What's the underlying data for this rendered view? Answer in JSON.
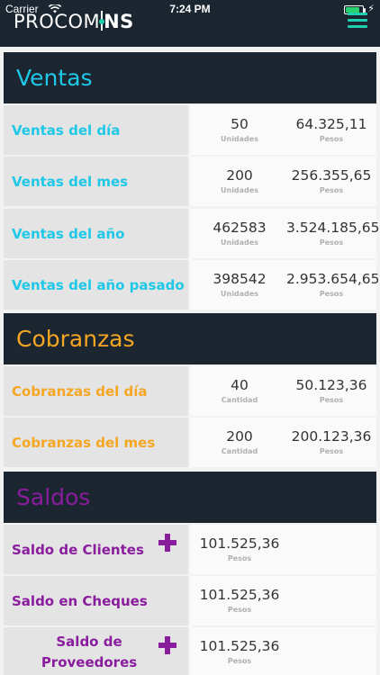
{
  "status_bar": {
    "carrier": "Carrier",
    "time": "7:24 PM"
  },
  "app": {
    "logo_light": "PROCOM",
    "logo_bold": "NS"
  },
  "colors": {
    "ventas": "#1ec8e6",
    "cobranzas": "#f5a623",
    "saldos": "#8a1c9e",
    "header_bg": "#1b2631"
  },
  "ventas": {
    "title": "Ventas",
    "rows": [
      {
        "label": "Ventas del día",
        "qty": "50",
        "qty_unit": "Unidades",
        "amount": "64.325,11",
        "amount_unit": "Pesos"
      },
      {
        "label": "Ventas del mes",
        "qty": "200",
        "qty_unit": "Unidades",
        "amount": "256.355,65",
        "amount_unit": "Pesos"
      },
      {
        "label": "Ventas del año",
        "qty": "462583",
        "qty_unit": "Unidades",
        "amount": "3.524.185,65",
        "amount_unit": "Pesos"
      },
      {
        "label": "Ventas del año pasado",
        "qty": "398542",
        "qty_unit": "Unidades",
        "amount": "2.953.654,65",
        "amount_unit": "Pesos"
      }
    ]
  },
  "cobranzas": {
    "title": "Cobranzas",
    "rows": [
      {
        "label": "Cobranzas del día",
        "qty": "40",
        "qty_unit": "Cantidad",
        "amount": "50.123,36",
        "amount_unit": "Pesos"
      },
      {
        "label": "Cobranzas del mes",
        "qty": "200",
        "qty_unit": "Cantidad",
        "amount": "200.123,36",
        "amount_unit": "Pesos"
      }
    ]
  },
  "saldos": {
    "title": "Saldos",
    "rows": [
      {
        "label": "Saldo de Clientes",
        "amount": "101.525,36",
        "amount_unit": "Pesos"
      },
      {
        "label": "Saldo en Cheques",
        "amount": "101.525,36",
        "amount_unit": "Pesos"
      },
      {
        "label_line1": "Saldo de",
        "label_line2": "Proveedores",
        "amount": "101.525,36",
        "amount_unit": "Pesos"
      }
    ]
  }
}
